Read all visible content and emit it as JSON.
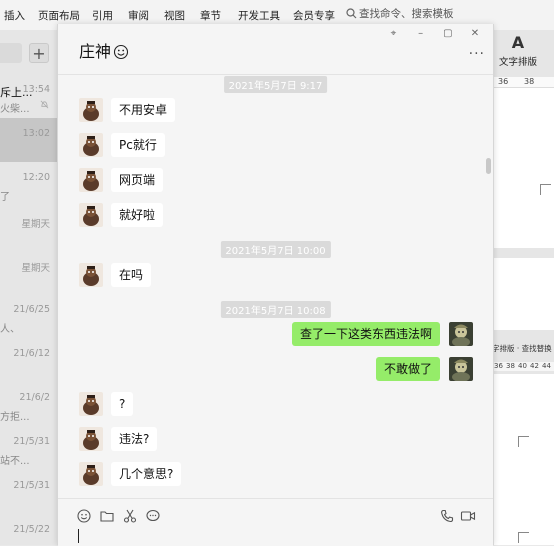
{
  "app_menu": [
    "插入",
    "页面布局",
    "引用",
    "审阅",
    "视图",
    "章节",
    "开发工具",
    "会员专享"
  ],
  "app_search_placeholder": "查找命令、搜索模板",
  "doc_tool": {
    "icon_text": "A",
    "label": "文字排版"
  },
  "doc_ruler": [
    "36",
    "38"
  ],
  "doc_mini_toolbar": "字排版 ·  查找替换 ·",
  "doc_mini_ruler": [
    "36",
    "38",
    "40",
    "42",
    "44"
  ],
  "sidebar": {
    "add_label": "+",
    "items": [
      {
        "name": "斥上...",
        "preview": "火柴...",
        "time": "13:54",
        "muted": true,
        "selected": false
      },
      {
        "name": "",
        "preview": "",
        "time": "13:02",
        "muted": false,
        "selected": true
      },
      {
        "name": "",
        "preview": "了",
        "time": "12:20",
        "muted": false,
        "selected": false
      },
      {
        "name": "",
        "preview": "",
        "time": "星期天",
        "muted": false,
        "selected": false
      },
      {
        "name": "",
        "preview": "",
        "time": "星期天",
        "muted": false,
        "selected": false
      },
      {
        "name": "",
        "preview": "人、",
        "time": "21/6/25",
        "muted": false,
        "selected": false
      },
      {
        "name": "",
        "preview": "",
        "time": "21/6/12",
        "muted": false,
        "selected": false
      },
      {
        "name": "",
        "preview": "方拒...",
        "time": "21/6/2",
        "muted": false,
        "selected": false
      },
      {
        "name": "",
        "preview": "站不...",
        "time": "21/5/31",
        "muted": false,
        "selected": false
      },
      {
        "name": "",
        "preview": "",
        "time": "21/5/31",
        "muted": false,
        "selected": false
      },
      {
        "name": "",
        "preview": "",
        "time": "21/5/22",
        "muted": false,
        "selected": false
      }
    ]
  },
  "chat": {
    "title": "庄神",
    "title_emoji": "smiley-emoji-icon",
    "window_buttons": {
      "pin": "⌖",
      "minimize": "–",
      "maximize": "▢",
      "close": "✕"
    },
    "more_label": "···",
    "timestamps": [
      "2021年5月7日 9:17",
      "2021年5月7日 10:00",
      "2021年5月7日 10:08"
    ],
    "messages": [
      {
        "side": "left",
        "text": "不用安卓"
      },
      {
        "side": "left",
        "text": "Pc就行"
      },
      {
        "side": "left",
        "text": "网页端"
      },
      {
        "side": "left",
        "text": "就好啦"
      },
      {
        "side": "left",
        "text": "在吗"
      },
      {
        "side": "right",
        "text": "查了一下这类东西违法啊"
      },
      {
        "side": "right",
        "text": "不敢做了"
      },
      {
        "side": "left",
        "text": "?"
      },
      {
        "side": "left",
        "text": "违法?"
      },
      {
        "side": "left",
        "text": "几个意思?"
      }
    ]
  },
  "colors": {
    "my_bubble": "#95ec69",
    "other_bubble": "#ffffff",
    "chat_bg": "#f5f5f5"
  }
}
